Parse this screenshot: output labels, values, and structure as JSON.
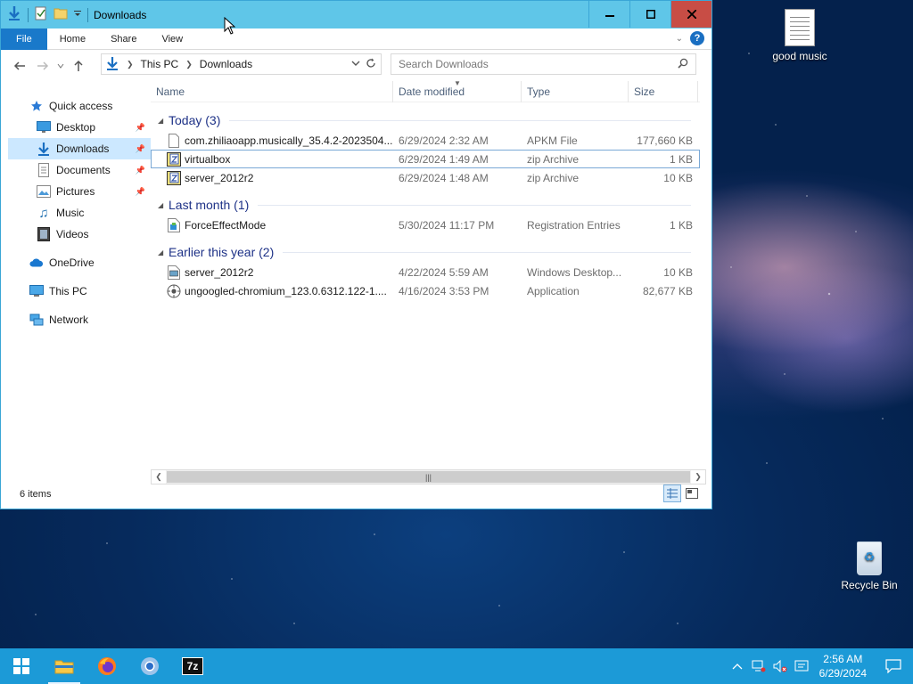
{
  "window": {
    "title": "Downloads",
    "controls": {
      "minimize": "minimize",
      "maximize": "maximize",
      "close": "close"
    }
  },
  "ribbon": {
    "tabs": [
      {
        "label": "File"
      },
      {
        "label": "Home"
      },
      {
        "label": "Share"
      },
      {
        "label": "View"
      }
    ]
  },
  "address": {
    "crumbs": [
      "This PC",
      "Downloads"
    ]
  },
  "search": {
    "placeholder": "Search Downloads"
  },
  "navpane": {
    "quick_access": "Quick access",
    "items": [
      {
        "label": "Desktop",
        "icon": "desktop-icon",
        "pinned": true
      },
      {
        "label": "Downloads",
        "icon": "downloads-icon",
        "pinned": true,
        "active": true
      },
      {
        "label": "Documents",
        "icon": "documents-icon",
        "pinned": true
      },
      {
        "label": "Pictures",
        "icon": "pictures-icon",
        "pinned": true
      },
      {
        "label": "Music",
        "icon": "music-icon",
        "pinned": false
      },
      {
        "label": "Videos",
        "icon": "videos-icon",
        "pinned": false
      }
    ],
    "onedrive": "OneDrive",
    "this_pc": "This PC",
    "network": "Network"
  },
  "columns": {
    "name": "Name",
    "date": "Date modified",
    "type": "Type",
    "size": "Size"
  },
  "groups": [
    {
      "title": "Today (3)",
      "files": [
        {
          "name": "com.zhiliaoapp.musically_35.4.2-2023504...",
          "date": "6/29/2024 2:32 AM",
          "type": "APKM File",
          "size": "177,660 KB",
          "icon": "blank-file-icon"
        },
        {
          "name": "virtualbox",
          "date": "6/29/2024 1:49 AM",
          "type": "zip Archive",
          "size": "1 KB",
          "icon": "zip-archive-icon",
          "selected": true
        },
        {
          "name": "server_2012r2",
          "date": "6/29/2024 1:48 AM",
          "type": "zip Archive",
          "size": "10 KB",
          "icon": "zip-archive-icon"
        }
      ]
    },
    {
      "title": "Last month (1)",
      "files": [
        {
          "name": "ForceEffectMode",
          "date": "5/30/2024 11:17 PM",
          "type": "Registration Entries",
          "size": "1 KB",
          "icon": "registry-file-icon"
        }
      ]
    },
    {
      "title": "Earlier this year (2)",
      "files": [
        {
          "name": "server_2012r2",
          "date": "4/22/2024 5:59 AM",
          "type": "Windows Desktop...",
          "size": "10 KB",
          "icon": "rdp-file-icon"
        },
        {
          "name": "ungoogled-chromium_123.0.6312.122-1....",
          "date": "4/16/2024 3:53 PM",
          "type": "Application",
          "size": "82,677 KB",
          "icon": "application-icon"
        }
      ]
    }
  ],
  "status": {
    "item_count": "6 items"
  },
  "desktop": {
    "icons": [
      {
        "label": "good music"
      },
      {
        "label": "Recycle Bin"
      }
    ]
  },
  "taskbar": {
    "apps": [
      "start",
      "file-explorer",
      "firefox",
      "chrome",
      "7-zip"
    ],
    "seven_zip_label": "7z",
    "clock_time": "2:56 AM",
    "clock_date": "6/29/2024"
  },
  "colors": {
    "titlebar": "#5fc6e8",
    "file_tab": "#1979ca",
    "close_button": "#c84d45",
    "taskbar": "#1c9ad7",
    "group_title": "#1e3287"
  }
}
